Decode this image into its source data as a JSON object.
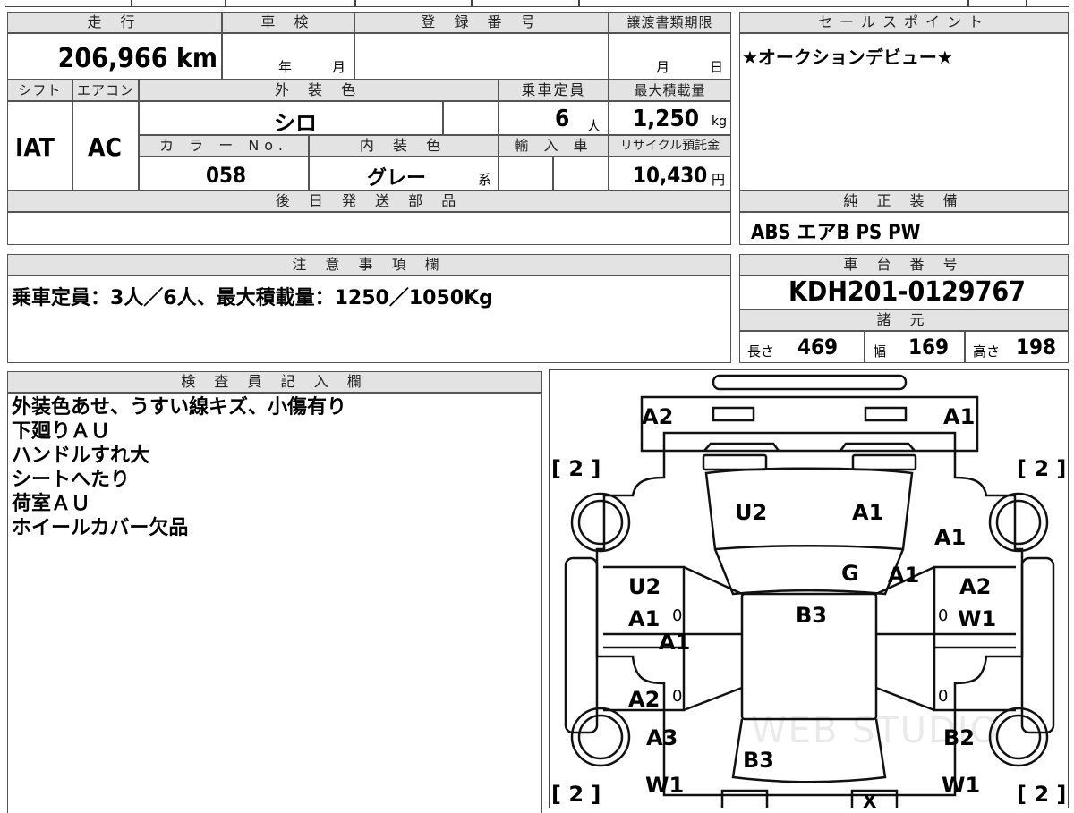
{
  "top_strip": {
    "text_1": "",
    "text_2": ""
  },
  "headers": {
    "mileage": "走 行",
    "shaken": "車 検",
    "reg_number": "登 録 番 号",
    "transfer_deadline": "譲渡書類期限",
    "sales_point": "セールスポイント",
    "shift": "シフト",
    "aircon": "エアコン",
    "exterior_color": "外 装 色",
    "capacity": "乗車定員",
    "max_load": "最大積載量",
    "color_no": "カ ラ ー No.",
    "interior_color": "内 装 色",
    "import": "輸 入 車",
    "recycle": "リサイクル預託金",
    "later_parts": "後 日 発 送 部 品",
    "genuine_equipment": "純 正 装 備",
    "notes": "注 意 事 項 欄",
    "chassis_number": "車 台 番 号",
    "specs": "諸 元",
    "inspector": "検 査 員 記 入 欄"
  },
  "values": {
    "mileage": "206,966 km",
    "shaken_year": "年",
    "shaken_month": "月",
    "deadline_month": "月",
    "deadline_day": "日",
    "sales_point": "★オークションデビュー★",
    "shift": "IAT",
    "aircon": "AC",
    "exterior_color": "シロ",
    "capacity_num": "6",
    "capacity_unit": "人",
    "max_load_num": "1,250",
    "max_load_unit": "kg",
    "color_no": "058",
    "interior_color": "グレー",
    "interior_suffix": "系",
    "recycle_num": "10,430",
    "recycle_unit": "円",
    "genuine_equipment": "ABS エアB PS PW",
    "notes": "乗車定員：3人／6人、最大積載量：1250／1050Kg",
    "chassis_number": "KDH201-0129767",
    "length_label": "長さ",
    "length": "469",
    "width_label": "幅",
    "width": "169",
    "height_label": "高さ",
    "height": "198"
  },
  "inspector_notes": [
    "外装色あせ、うすい線キズ、小傷有り",
    "下廻りＡＵ",
    "ハンドルすれ大",
    "シートへたり",
    "荷室ＡＵ",
    "ホイールカバー欠品"
  ],
  "diagram": {
    "watermark": "WEB STUDIO",
    "brackets": {
      "tl": "[ 2 ]",
      "tr": "[ 2 ]",
      "bl": "[ 2 ]",
      "br": "[ 2 ]"
    },
    "marks": {
      "front_left": "A2",
      "front_right": "A1",
      "windshield_left": "U2",
      "windshield_right": "A1",
      "fender_right": "A1",
      "hood_g": "G",
      "hood_a1": "A1",
      "roof": "B3",
      "left_front_door_1": "U2",
      "left_front_door_2": "A1",
      "left_front_door_3": "A1",
      "left_rear_door": "A2",
      "right_front_door_1": "A2",
      "right_front_door_2": "W1",
      "left_quarter": "A3",
      "left_rear_wheel": "W1",
      "rear_glass": "B3",
      "right_quarter": "B2",
      "right_rear_wheel": "W1",
      "zero": "0",
      "rear_x": "X"
    }
  }
}
